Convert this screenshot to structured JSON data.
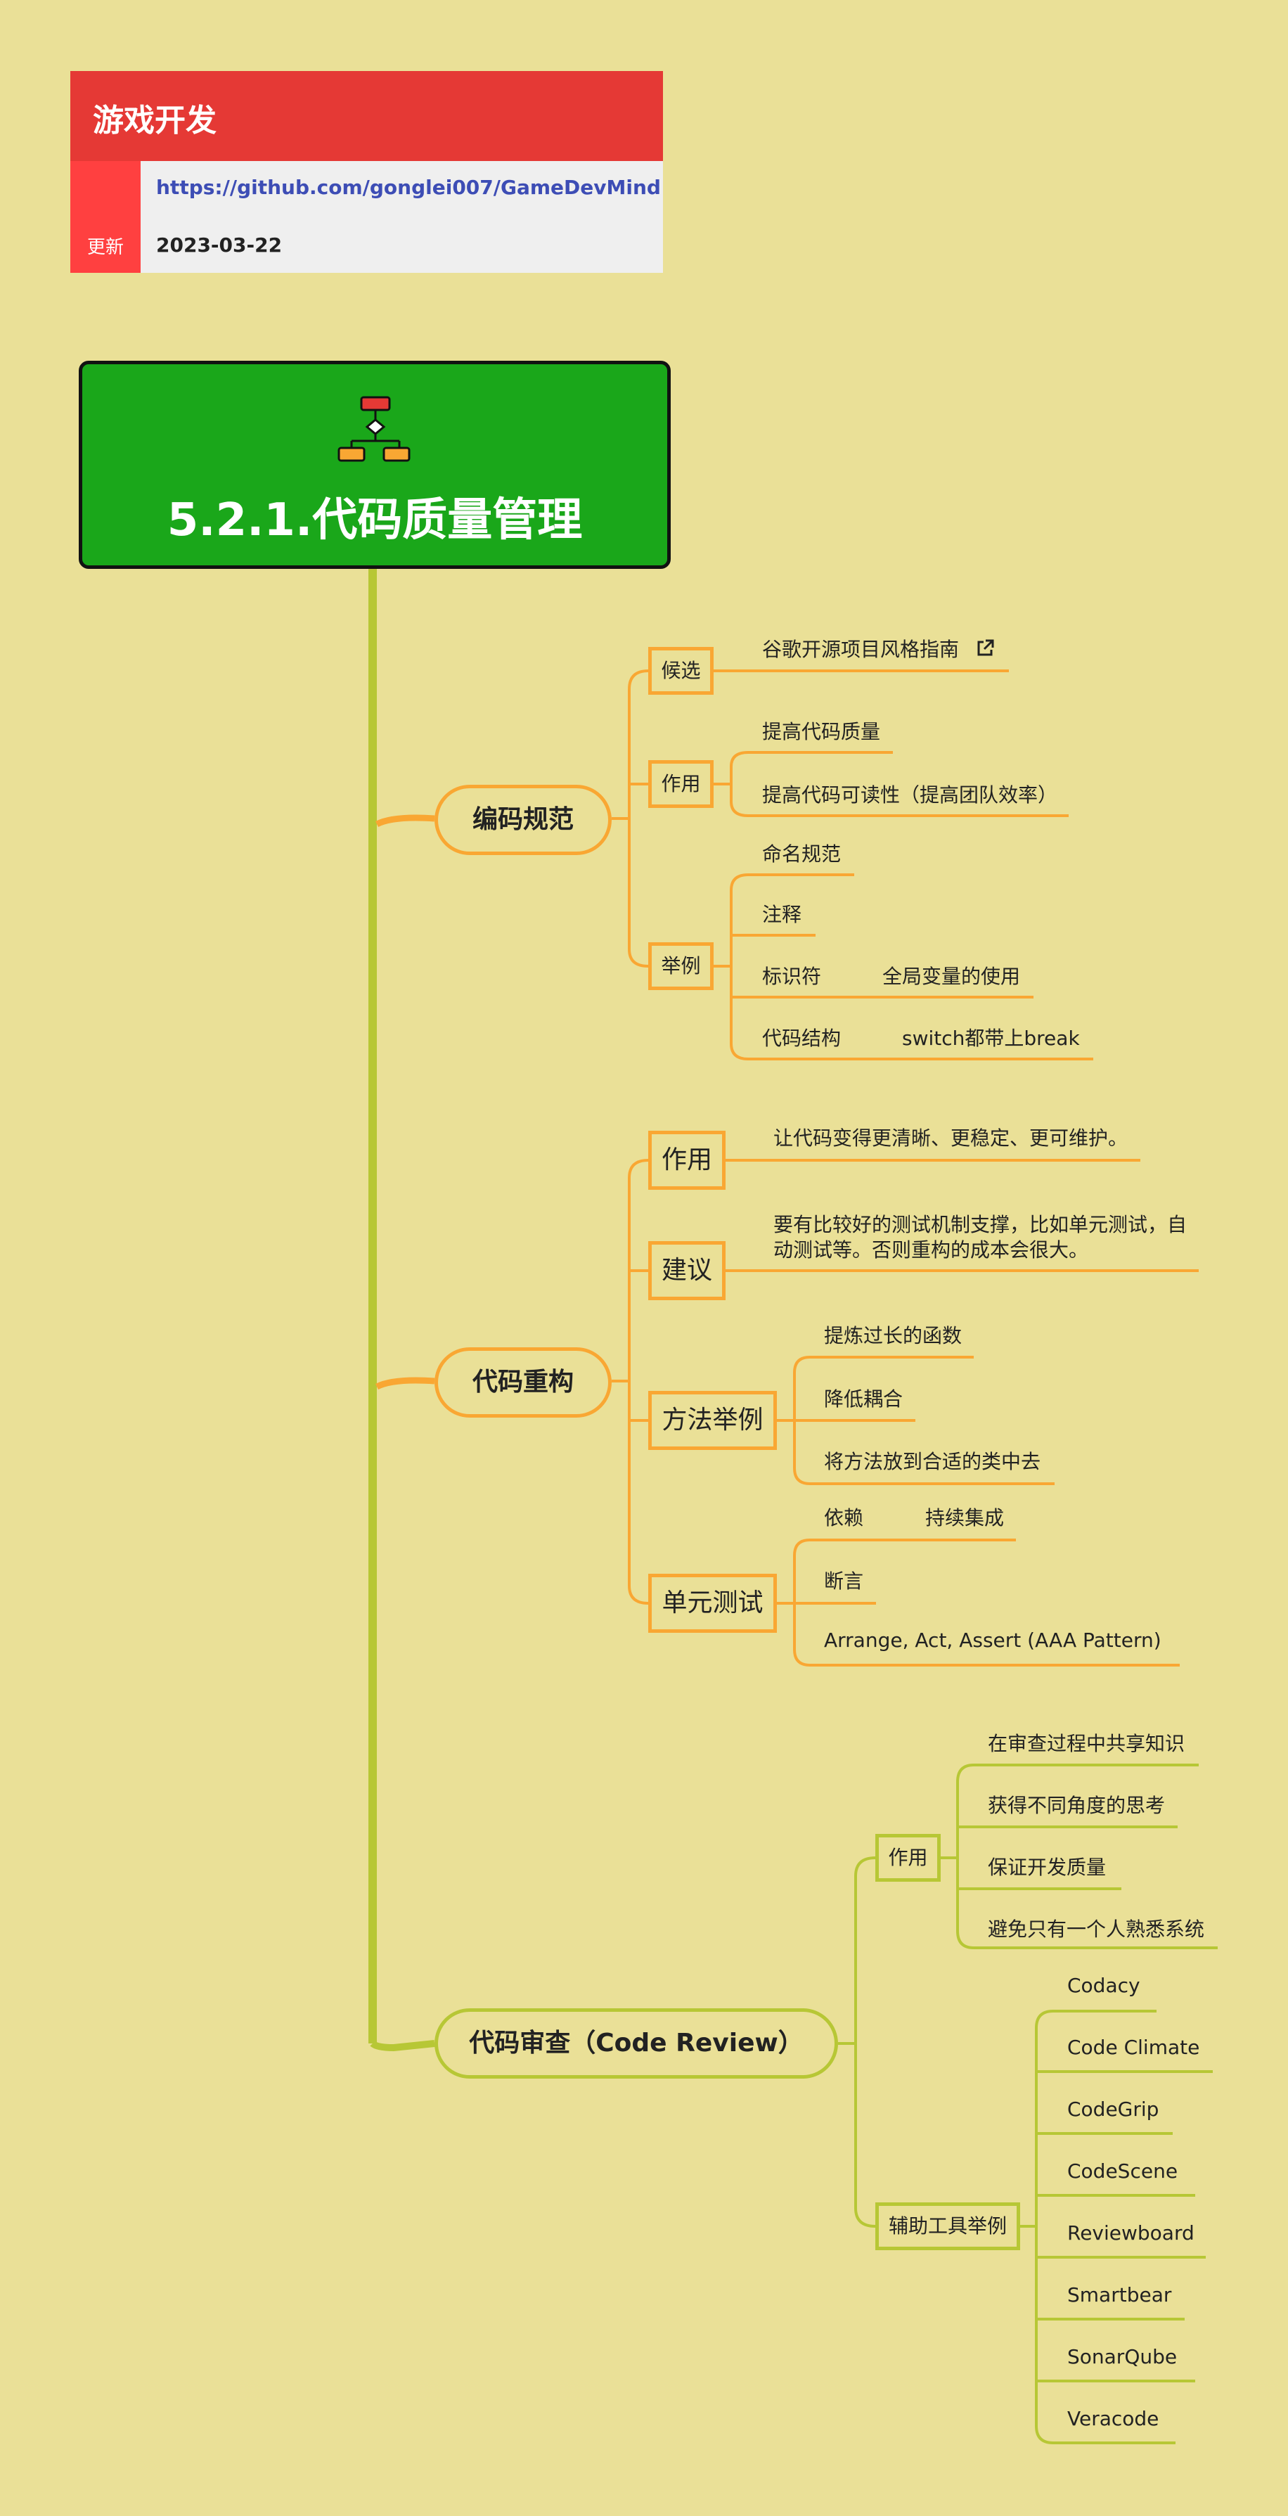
{
  "header": {
    "title": "游戏开发",
    "side_label": "更新",
    "url": "https://github.com/gonglei007/GameDevMind",
    "date": "2023-03-22"
  },
  "root": {
    "title": "5.2.1.代码质量管理",
    "icon": "flowchart-icon"
  },
  "colors": {
    "background": "#EAE097",
    "root": "#1AA71A",
    "orange": "#F9A733",
    "green": "#B7C735",
    "header_red": "#E53935"
  },
  "branches": [
    {
      "label": "编码规范",
      "children": [
        {
          "label": "候选",
          "leaves": [
            "谷歌开源项目风格指南"
          ]
        },
        {
          "label": "作用",
          "leaves": [
            "提高代码质量",
            "提高代码可读性（提高团队效率）"
          ]
        },
        {
          "label": "举例",
          "leaves": [
            "命名规范",
            "注释",
            "标识符",
            "代码结构"
          ],
          "sub": [
            "全局变量的使用",
            "switch都带上break"
          ]
        }
      ]
    },
    {
      "label": "代码重构",
      "children": [
        {
          "label": "作用",
          "leaves": [
            "让代码变得更清晰、更稳定、更可维护。"
          ]
        },
        {
          "label": "建议",
          "leaves": [
            "要有比较好的测试机制支撑，比如单元测试，自",
            "动测试等。否则重构的成本会很大。"
          ]
        },
        {
          "label": "方法举例",
          "leaves": [
            "提炼过长的函数",
            "降低耦合",
            "将方法放到合适的类中去"
          ]
        },
        {
          "label": "单元测试",
          "leaves": [
            "依赖",
            "断言",
            "Arrange, Act, Assert (AAA Pattern)"
          ],
          "sub": [
            "持续集成"
          ]
        }
      ]
    },
    {
      "label": "代码审查（Code Review）",
      "children": [
        {
          "label": "作用",
          "leaves": [
            "在审查过程中共享知识",
            "获得不同角度的思考",
            "保证开发质量",
            "避免只有一个人熟悉系统"
          ]
        },
        {
          "label": "辅助工具举例",
          "leaves": [
            "Codacy",
            "Code Climate",
            "CodeGrip",
            "CodeScene",
            "Reviewboard",
            "Smartbear",
            "SonarQube",
            "Veracode"
          ]
        }
      ]
    }
  ]
}
